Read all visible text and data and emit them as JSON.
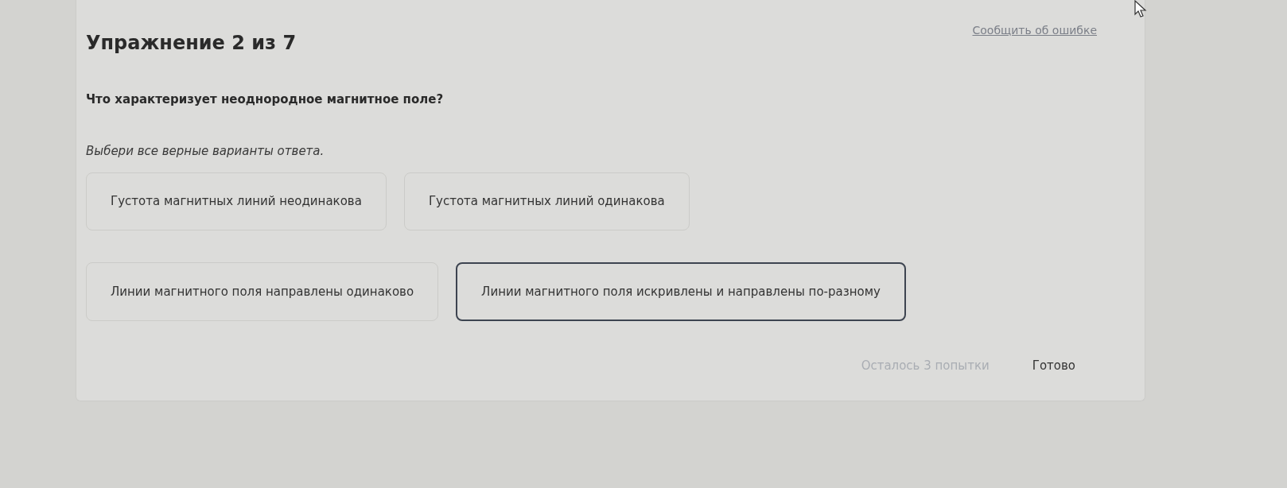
{
  "exercise_title": "Упражнение 2 из 7",
  "report_link": "Сообщить об ошибке",
  "question": "Что характеризует неоднородное магнитное поле?",
  "instruction": "Выбери все верные варианты ответа.",
  "options": [
    {
      "text": "Густота магнитных линий неодинакова",
      "selected": false
    },
    {
      "text": "Густота магнитных линий одинакова",
      "selected": false
    },
    {
      "text": "Линии магнитного поля направлены одинаково",
      "selected": false
    },
    {
      "text": "Линии магнитного поля искривлены и направлены по-разному",
      "selected": true
    }
  ],
  "attempts": "Осталось 3 попытки",
  "submit": "Готово"
}
